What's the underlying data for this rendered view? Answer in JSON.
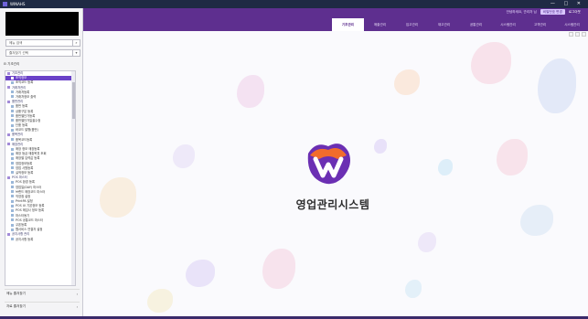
{
  "titlebar": {
    "title": "WINAHS",
    "window_controls": "— □ ✕"
  },
  "header": {
    "user_text": "안녕하세요, 관리자 님",
    "password_button": "비밀번호 변경",
    "logout": "로그아웃",
    "tabs": [
      {
        "label": "기초관리",
        "active": true
      },
      {
        "label": "매출관리",
        "active": false
      },
      {
        "label": "입고관리",
        "active": false
      },
      {
        "label": "재고관리",
        "active": false
      },
      {
        "label": "공통관리",
        "active": false
      },
      {
        "label": "시스템관리",
        "active": false
      },
      {
        "label": "고객관리",
        "active": false
      },
      {
        "label": "시스템관리",
        "active": false
      }
    ]
  },
  "sidebar": {
    "search_placeholder": "메뉴 검색",
    "favorite_placeholder": "즐겨찾기 선택",
    "root_label": "기초관리",
    "nodes": [
      {
        "label": "기초관리",
        "type": "folder"
      },
      {
        "label": "조직정보",
        "type": "leaf",
        "selected": true
      },
      {
        "label": "조직코드 등록",
        "type": "leaf"
      },
      {
        "label": "거래처관리",
        "type": "folder"
      },
      {
        "label": "거래처등록",
        "type": "leaf"
      },
      {
        "label": "거래처정보 출력",
        "type": "leaf"
      },
      {
        "label": "품번관리",
        "type": "folder"
      },
      {
        "label": "품번 등록",
        "type": "leaf"
      },
      {
        "label": "상품구분 등록",
        "type": "leaf"
      },
      {
        "label": "품번별단가등록",
        "type": "leaf"
      },
      {
        "label": "품번별단가일괄수정",
        "type": "leaf"
      },
      {
        "label": "단품 등록",
        "type": "leaf"
      },
      {
        "label": "바코드 발행(품번)",
        "type": "leaf"
      },
      {
        "label": "품목관리",
        "type": "folder"
      },
      {
        "label": "품목코드등록",
        "type": "leaf"
      },
      {
        "label": "매장관리",
        "type": "folder"
      },
      {
        "label": "매장 정보 매장등록",
        "type": "leaf"
      },
      {
        "label": "매장 등급 매출목표 조회",
        "type": "leaf"
      },
      {
        "label": "매장별 입력값 등록",
        "type": "leaf"
      },
      {
        "label": "영업정보등록",
        "type": "leaf"
      },
      {
        "label": "영업 사원등록",
        "type": "leaf"
      },
      {
        "label": "실적정보 등록",
        "type": "leaf"
      },
      {
        "label": "POS 마스터",
        "type": "folder"
      },
      {
        "label": "POS 환경 등록",
        "type": "leaf"
      },
      {
        "label": "영업일(DAY) 마스터",
        "type": "leaf"
      },
      {
        "label": "브랜드 매장코드 마스터",
        "type": "leaf"
      },
      {
        "label": "직영점 설정",
        "type": "leaf"
      },
      {
        "label": "PrintPA 설정",
        "type": "leaf"
      },
      {
        "label": "POS UI 기본정보 등록",
        "type": "leaf"
      },
      {
        "label": "POS 매입사 정보 등록",
        "type": "leaf"
      },
      {
        "label": "마스터동기",
        "type": "leaf"
      },
      {
        "label": "POS 공통코드 마스터",
        "type": "leaf"
      },
      {
        "label": "쿠폰등록",
        "type": "leaf"
      },
      {
        "label": "웹서비스 연결자 설정",
        "type": "leaf"
      },
      {
        "label": "공지사항 관리",
        "type": "folder"
      },
      {
        "label": "공지사항 등록",
        "type": "leaf"
      }
    ],
    "bottom_items": [
      {
        "label": "메뉴 즐겨찾기"
      },
      {
        "label": "자료 즐겨찾기"
      }
    ]
  },
  "main": {
    "system_title": "영업관리시스템"
  },
  "colors": {
    "brand_purple": "#5e2f8f",
    "selected": "#6b42c8",
    "logo_orange": "#f26c2c",
    "logo_purple": "#6b2fb3"
  }
}
